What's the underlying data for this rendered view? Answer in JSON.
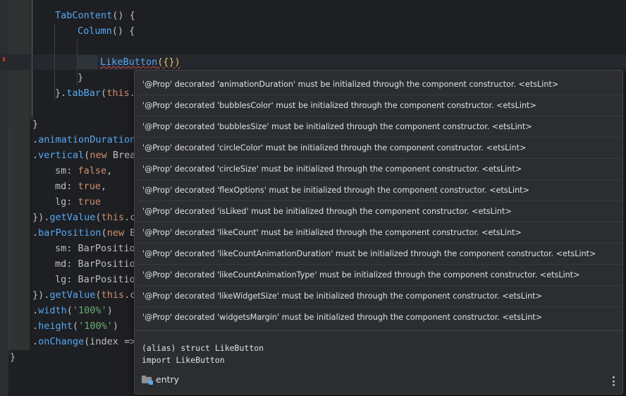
{
  "editor": {
    "lines": [
      {
        "id": "l1",
        "parts": [
          [
            "fn",
            "TabContent"
          ],
          [
            "punct",
            "() {"
          ]
        ]
      },
      {
        "id": "l2",
        "parts": [
          [
            "fn",
            "Column"
          ],
          [
            "punct",
            "() {"
          ]
        ]
      },
      {
        "id": "l3",
        "parts": []
      },
      {
        "id": "l4",
        "parts": [
          [
            "fn",
            "LikeButton"
          ],
          [
            "brace",
            "({})"
          ]
        ]
      },
      {
        "id": "l5",
        "parts": [
          [
            "punct",
            "}"
          ]
        ]
      },
      {
        "id": "l6",
        "parts": [
          [
            "punct",
            "}."
          ],
          [
            "fn",
            "tabBar"
          ],
          [
            "punct",
            "("
          ],
          [
            "kw",
            "this"
          ],
          [
            "punct",
            "."
          ]
        ]
      },
      {
        "id": "l7",
        "parts": []
      },
      {
        "id": "l8",
        "parts": [
          [
            "punct",
            "}"
          ]
        ]
      },
      {
        "id": "l9",
        "parts": [
          [
            "punct",
            "."
          ],
          [
            "fn",
            "animationDuration"
          ]
        ]
      },
      {
        "id": "l10",
        "parts": [
          [
            "punct",
            "."
          ],
          [
            "fn",
            "vertical"
          ],
          [
            "punct",
            "("
          ],
          [
            "kw",
            "new "
          ],
          [
            "plain",
            "Brea"
          ]
        ]
      },
      {
        "id": "l11",
        "parts": [
          [
            "plain",
            "sm: "
          ],
          [
            "kw",
            "false"
          ],
          [
            "punct",
            ","
          ]
        ]
      },
      {
        "id": "l12",
        "parts": [
          [
            "plain",
            "md: "
          ],
          [
            "kw",
            "true"
          ],
          [
            "punct",
            ","
          ]
        ]
      },
      {
        "id": "l13",
        "parts": [
          [
            "plain",
            "lg: "
          ],
          [
            "kw",
            "true"
          ]
        ]
      },
      {
        "id": "l14",
        "parts": [
          [
            "punct",
            "})."
          ],
          [
            "fn",
            "getValue"
          ],
          [
            "punct",
            "("
          ],
          [
            "kw",
            "this"
          ],
          [
            "punct",
            ".c"
          ]
        ]
      },
      {
        "id": "l15",
        "parts": [
          [
            "punct",
            "."
          ],
          [
            "fn",
            "barPosition"
          ],
          [
            "punct",
            "("
          ],
          [
            "kw",
            "new "
          ],
          [
            "plain",
            "B"
          ]
        ]
      },
      {
        "id": "l16",
        "parts": [
          [
            "plain",
            "sm: BarPositio"
          ]
        ]
      },
      {
        "id": "l17",
        "parts": [
          [
            "plain",
            "md: BarPositio"
          ]
        ]
      },
      {
        "id": "l18",
        "parts": [
          [
            "plain",
            "lg: BarPositio"
          ]
        ]
      },
      {
        "id": "l19",
        "parts": [
          [
            "punct",
            "})."
          ],
          [
            "fn",
            "getValue"
          ],
          [
            "punct",
            "("
          ],
          [
            "kw",
            "this"
          ],
          [
            "punct",
            ".c"
          ]
        ]
      },
      {
        "id": "l20",
        "parts": [
          [
            "punct",
            "."
          ],
          [
            "fn",
            "width"
          ],
          [
            "punct",
            "("
          ],
          [
            "str",
            "'100%'"
          ],
          [
            "punct",
            ")"
          ]
        ]
      },
      {
        "id": "l21",
        "parts": [
          [
            "punct",
            "."
          ],
          [
            "fn",
            "height"
          ],
          [
            "punct",
            "("
          ],
          [
            "str",
            "'100%'"
          ],
          [
            "punct",
            ")"
          ]
        ]
      },
      {
        "id": "l22",
        "parts": [
          [
            "punct",
            "."
          ],
          [
            "fn",
            "onChange"
          ],
          [
            "punct",
            "(index =>"
          ]
        ]
      },
      {
        "id": "l23",
        "parts": [
          [
            "punct",
            "}"
          ]
        ]
      }
    ]
  },
  "popup": {
    "messages": [
      "'@Prop' decorated 'animationDuration' must be initialized through the component constructor. <etsLint>",
      "'@Prop' decorated 'bubblesColor' must be initialized through the component constructor. <etsLint>",
      "'@Prop' decorated 'bubblesSize' must be initialized through the component constructor. <etsLint>",
      "'@Prop' decorated 'circleColor' must be initialized through the component constructor. <etsLint>",
      "'@Prop' decorated 'circleSize' must be initialized through the component constructor. <etsLint>",
      "'@Prop' decorated 'flexOptions' must be initialized through the component constructor. <etsLint>",
      "'@Prop' decorated 'isLiked' must be initialized through the component constructor. <etsLint>",
      "'@Prop' decorated 'likeCount' must be initialized through the component constructor. <etsLint>",
      "'@Prop' decorated 'likeCountAnimationDuration' must be initialized through the component constructor. <etsLint>",
      "'@Prop' decorated 'likeCountAnimationType' must be initialized through the component constructor. <etsLint>",
      "'@Prop' decorated 'likeWidgetSize' must be initialized through the component constructor. <etsLint>",
      "'@Prop' decorated 'widgetsMargin' must be initialized through the component constructor. <etsLint>"
    ],
    "doc": {
      "signature": "(alias) struct LikeButton",
      "import_line": "import LikeButton"
    },
    "module": {
      "icon": "folder-module-icon",
      "label": "entry"
    },
    "more_icon": "kebab-menu-icon"
  },
  "colors": {
    "background": "#1e1f22",
    "popup_background": "#2b2d30",
    "keyword": "#cf8e6d",
    "function": "#56a8f5",
    "string": "#6aab73",
    "text": "#bcbec4",
    "error_underline": "#c94f4f"
  }
}
